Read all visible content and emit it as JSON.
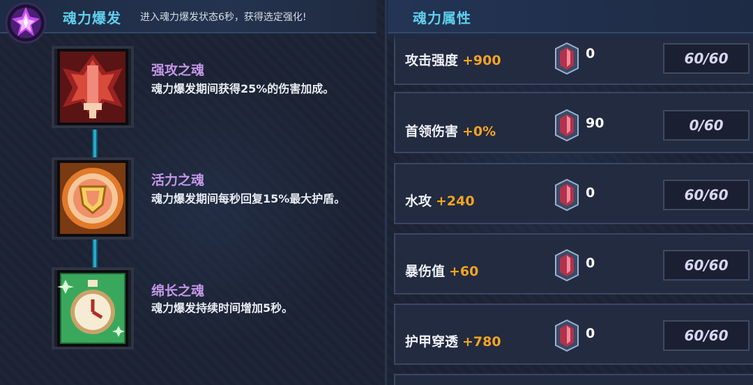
{
  "burst": {
    "title": "魂力爆发",
    "description": "进入魂力爆发状态6秒，获得选定强化!"
  },
  "skills": [
    {
      "name": "强攻之魂",
      "desc": "魂力爆发期间获得25%的伤害加成。",
      "icon": "red-spirit-icon"
    },
    {
      "name": "活力之魂",
      "desc": "魂力爆发期间每秒回复15%最大护盾。",
      "icon": "shield-spirit-icon"
    },
    {
      "name": "绵长之魂",
      "desc": "魂力爆发持续时间增加5秒。",
      "icon": "stopwatch-spirit-icon"
    }
  ],
  "attributes": {
    "title": "魂力属性",
    "rows": [
      {
        "label": "攻击强度",
        "bonus": "+900",
        "gems": "0",
        "level": "60/60"
      },
      {
        "label": "首领伤害",
        "bonus": "+0%",
        "gems": "90",
        "level": "0/60"
      },
      {
        "label": "水攻",
        "bonus": "+240",
        "gems": "0",
        "level": "60/60"
      },
      {
        "label": "暴伤值",
        "bonus": "+60",
        "gems": "0",
        "level": "60/60"
      },
      {
        "label": "护甲穿透",
        "bonus": "+780",
        "gems": "0",
        "level": "60/60"
      }
    ]
  },
  "colors": {
    "title_cyan": "#5fd0ec",
    "skill_name_purple": "#c497e8",
    "bonus_orange": "#f6a424",
    "chain_blue": "#2aa8c8"
  }
}
